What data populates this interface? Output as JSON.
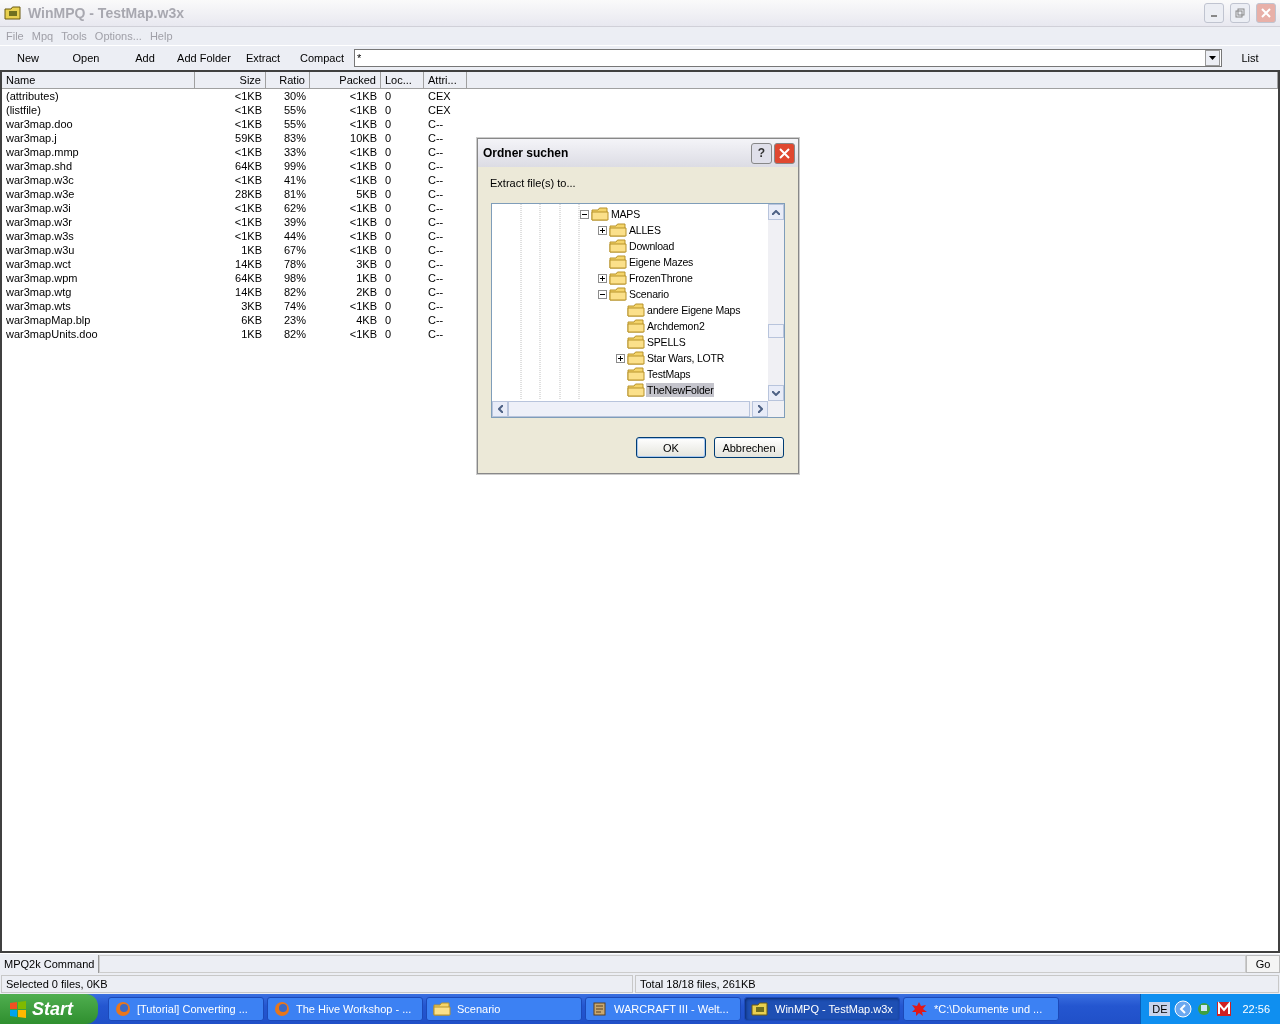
{
  "window": {
    "title": "WinMPQ - TestMap.w3x"
  },
  "menu": [
    "File",
    "Mpq",
    "Tools",
    "Options...",
    "Help"
  ],
  "toolbar": {
    "buttons": [
      "New",
      "Open",
      "Add",
      "Add Folder",
      "Extract",
      "Compact"
    ],
    "filter": {
      "value": "*"
    },
    "list_button": "List"
  },
  "table": {
    "columns": [
      "Name",
      "Size",
      "Ratio",
      "Packed",
      "Loc...",
      "Attri..."
    ],
    "rows": [
      [
        "(attributes)",
        "<1KB",
        "30%",
        "<1KB",
        "0",
        "CEX"
      ],
      [
        "(listfile)",
        "<1KB",
        "55%",
        "<1KB",
        "0",
        "CEX"
      ],
      [
        "war3map.doo",
        "<1KB",
        "55%",
        "<1KB",
        "0",
        "C--"
      ],
      [
        "war3map.j",
        "59KB",
        "83%",
        "10KB",
        "0",
        "C--"
      ],
      [
        "war3map.mmp",
        "<1KB",
        "33%",
        "<1KB",
        "0",
        "C--"
      ],
      [
        "war3map.shd",
        "64KB",
        "99%",
        "<1KB",
        "0",
        "C--"
      ],
      [
        "war3map.w3c",
        "<1KB",
        "41%",
        "<1KB",
        "0",
        "C--"
      ],
      [
        "war3map.w3e",
        "28KB",
        "81%",
        "5KB",
        "0",
        "C--"
      ],
      [
        "war3map.w3i",
        "<1KB",
        "62%",
        "<1KB",
        "0",
        "C--"
      ],
      [
        "war3map.w3r",
        "<1KB",
        "39%",
        "<1KB",
        "0",
        "C--"
      ],
      [
        "war3map.w3s",
        "<1KB",
        "44%",
        "<1KB",
        "0",
        "C--"
      ],
      [
        "war3map.w3u",
        "1KB",
        "67%",
        "<1KB",
        "0",
        "C--"
      ],
      [
        "war3map.wct",
        "14KB",
        "78%",
        "3KB",
        "0",
        "C--"
      ],
      [
        "war3map.wpm",
        "64KB",
        "98%",
        "1KB",
        "0",
        "C--"
      ],
      [
        "war3map.wtg",
        "14KB",
        "82%",
        "2KB",
        "0",
        "C--"
      ],
      [
        "war3map.wts",
        "3KB",
        "74%",
        "<1KB",
        "0",
        "C--"
      ],
      [
        "war3mapMap.blp",
        "6KB",
        "23%",
        "4KB",
        "0",
        "C--"
      ],
      [
        "war3mapUnits.doo",
        "1KB",
        "82%",
        "<1KB",
        "0",
        "C--"
      ]
    ]
  },
  "dialog": {
    "title": "Ordner suchen",
    "help": "?",
    "prompt": "Extract file(s) to...",
    "tree": [
      {
        "label": "MAPS",
        "expanded": true,
        "selected": false,
        "children": [
          {
            "label": "ALLES",
            "expanded": false,
            "selected": false
          },
          {
            "label": "Download",
            "selected": false
          },
          {
            "label": "Eigene Mazes",
            "selected": false
          },
          {
            "label": "FrozenThrone",
            "expanded": false,
            "selected": false
          },
          {
            "label": "Scenario",
            "expanded": true,
            "selected": false,
            "children": [
              {
                "label": "andere Eigene Maps",
                "selected": false
              },
              {
                "label": "Archdemon2",
                "selected": false
              },
              {
                "label": "SPELLS",
                "selected": false
              },
              {
                "label": "Star Wars, LOTR",
                "expanded": false,
                "selected": false
              },
              {
                "label": "TestMaps",
                "selected": false
              },
              {
                "label": "TheNewFolder",
                "selected": true
              }
            ]
          }
        ]
      }
    ],
    "buttons": [
      "OK",
      "Abbrechen"
    ]
  },
  "command": {
    "label": "MPQ2k Command",
    "button": "Go"
  },
  "status_bar": [
    "Selected 0 files, 0KB",
    "Total 18/18 files, 261KB"
  ],
  "taskbar": {
    "start": "Start",
    "items": [
      {
        "label": "[Tutorial] Converting ...",
        "kind": "firefox",
        "selected": false
      },
      {
        "label": "The Hive Workshop - ...",
        "kind": "firefox",
        "selected": false
      },
      {
        "label": "Scenario",
        "kind": "folder",
        "selected": false
      },
      {
        "label": "WARCRAFT III - Welt...",
        "kind": "scroll",
        "selected": false
      },
      {
        "label": "WinMPQ - TestMap.w3x",
        "kind": "winmpq",
        "selected": true
      },
      {
        "label": "*C:\\Dokumente und ...",
        "kind": "paint",
        "selected": false
      }
    ],
    "language": "DE",
    "clock": "22:56"
  }
}
